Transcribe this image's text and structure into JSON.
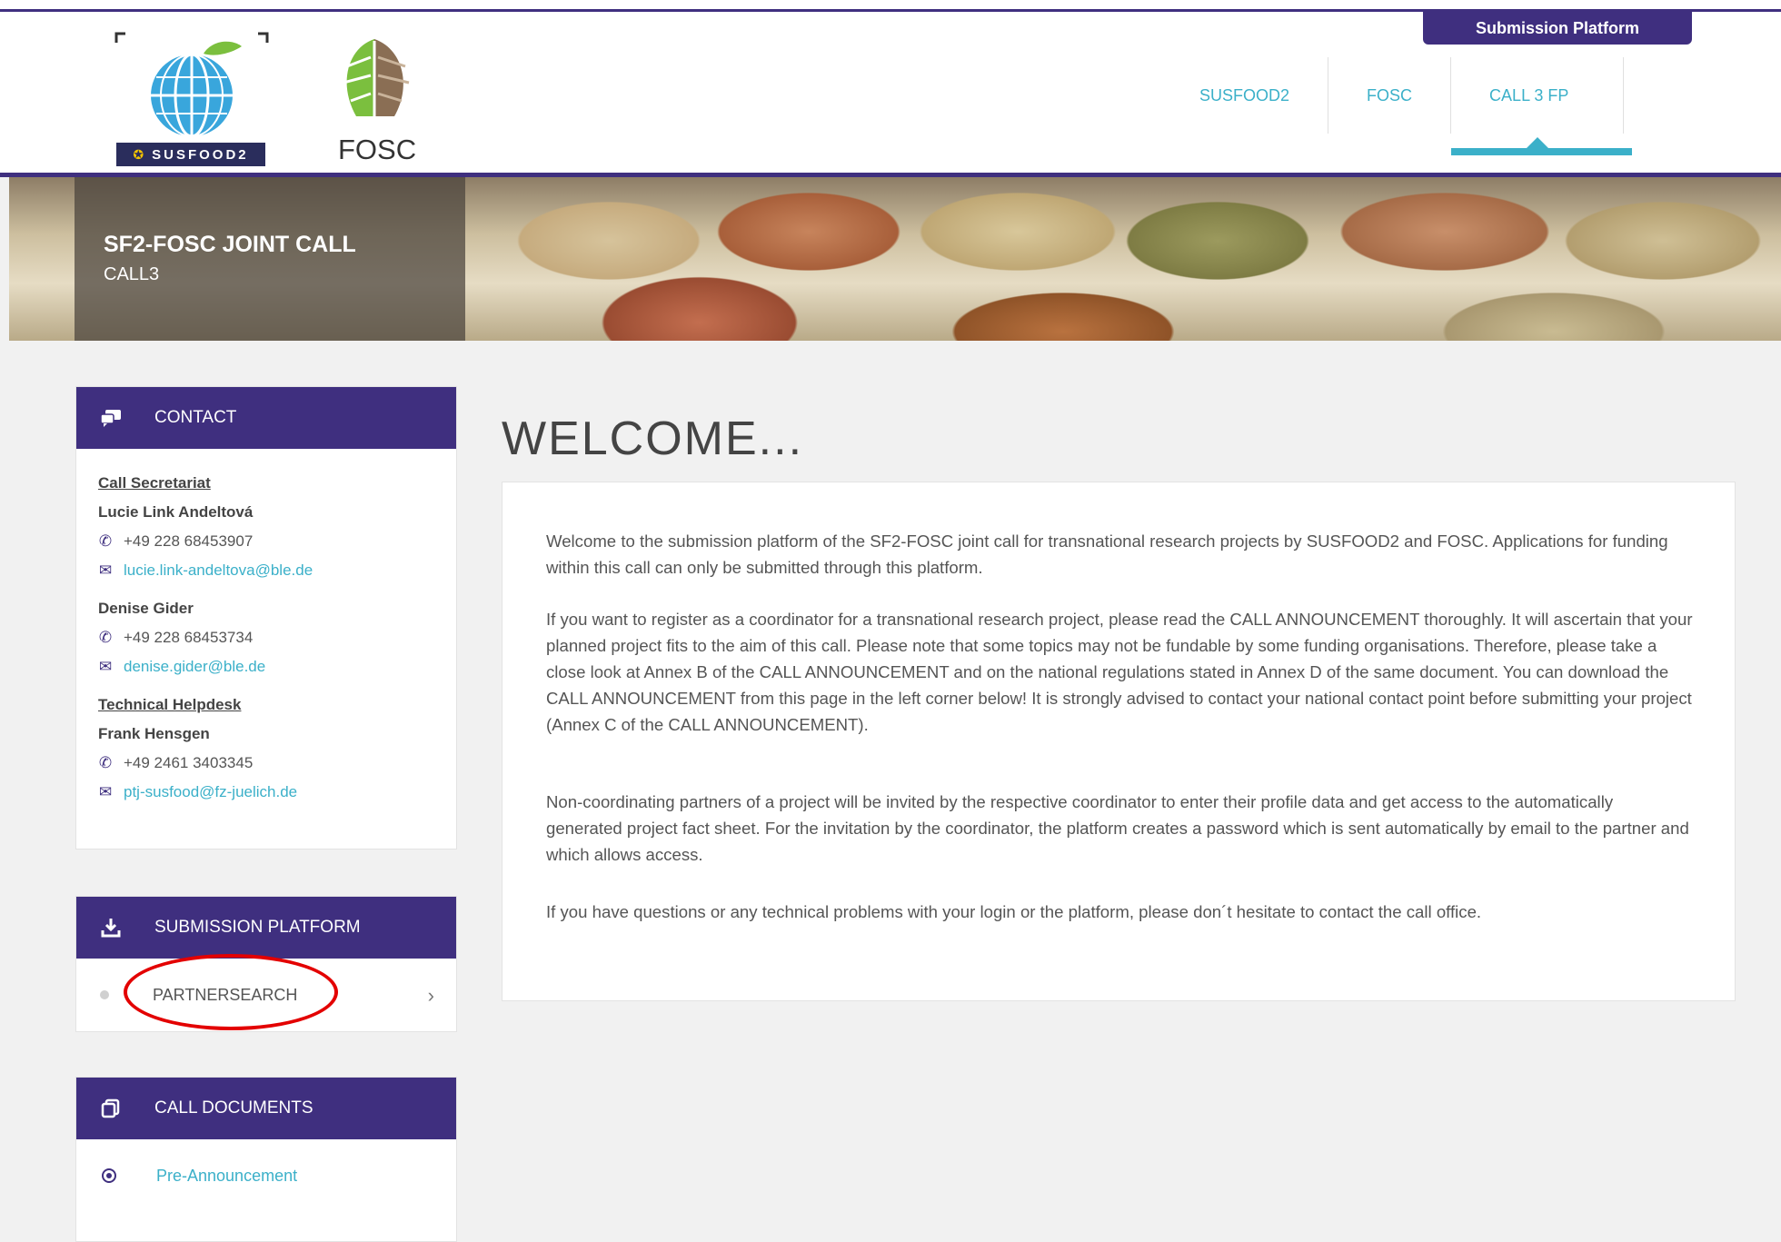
{
  "header": {
    "submission_tab": "Submission Platform",
    "logo_susfood": "SUSFOOD2",
    "logo_fosc": "FOSC",
    "nav": [
      "SUSFOOD2",
      "FOSC",
      "CALL 3 FP"
    ]
  },
  "hero": {
    "title": "SF2-FOSC JOINT CALL",
    "subtitle": "CALL3"
  },
  "contact": {
    "title": "CONTACT",
    "icon": "chat-bubbles-icon",
    "section1": "Call Secretariat",
    "person1": {
      "name": "Lucie Link Andeltová",
      "phone": "+49 228 68453907",
      "email": "lucie.link-andeltova@ble.de"
    },
    "person2": {
      "name": "Denise Gider",
      "phone": "+49 228 68453734",
      "email": "denise.gider@ble.de"
    },
    "section2": "Technical Helpdesk",
    "person3": {
      "name": "Frank Hensgen",
      "phone": "+49 2461 3403345",
      "email": "ptj-susfood@fz-juelich.de"
    }
  },
  "submission": {
    "title": "SUBMISSION PLATFORM",
    "icon": "download-icon",
    "item": "PARTNERSEARCH"
  },
  "documents": {
    "title": "CALL DOCUMENTS",
    "icon": "documents-icon",
    "item": "Pre-Announcement"
  },
  "main": {
    "title": "WELCOME...",
    "p1": "Welcome to the submission platform of the SF2-FOSC joint call for transnational research projects by SUSFOOD2 and FOSC. Applications for funding within this call can only be submitted through this platform.",
    "p2": "If you want to register as a coordinator for a transnational research project, please read the CALL ANNOUNCEMENT thoroughly. It will ascertain that your planned project fits to the aim of this call. Please note that some topics may not be fundable by some funding organisations. Therefore, please take a close look at Annex B of the CALL ANNOUNCEMENT and on the national regulations stated in Annex D of the same document. You can download the CALL ANNOUNCEMENT from this page in the left corner below! It is strongly advised to contact your national contact point before submitting your project (Annex C of the CALL ANNOUNCEMENT).",
    "p3": "Non-coordinating partners of a project will be invited by the respective coordinator to enter their profile data and get access to the automatically generated project fact sheet. For the invitation by the coordinator, the platform creates a password which is sent automatically by email to the partner and which allows access.",
    "p4": "If you have questions or any technical problems with your login or the platform, please don´t hesitate to contact the call office."
  }
}
